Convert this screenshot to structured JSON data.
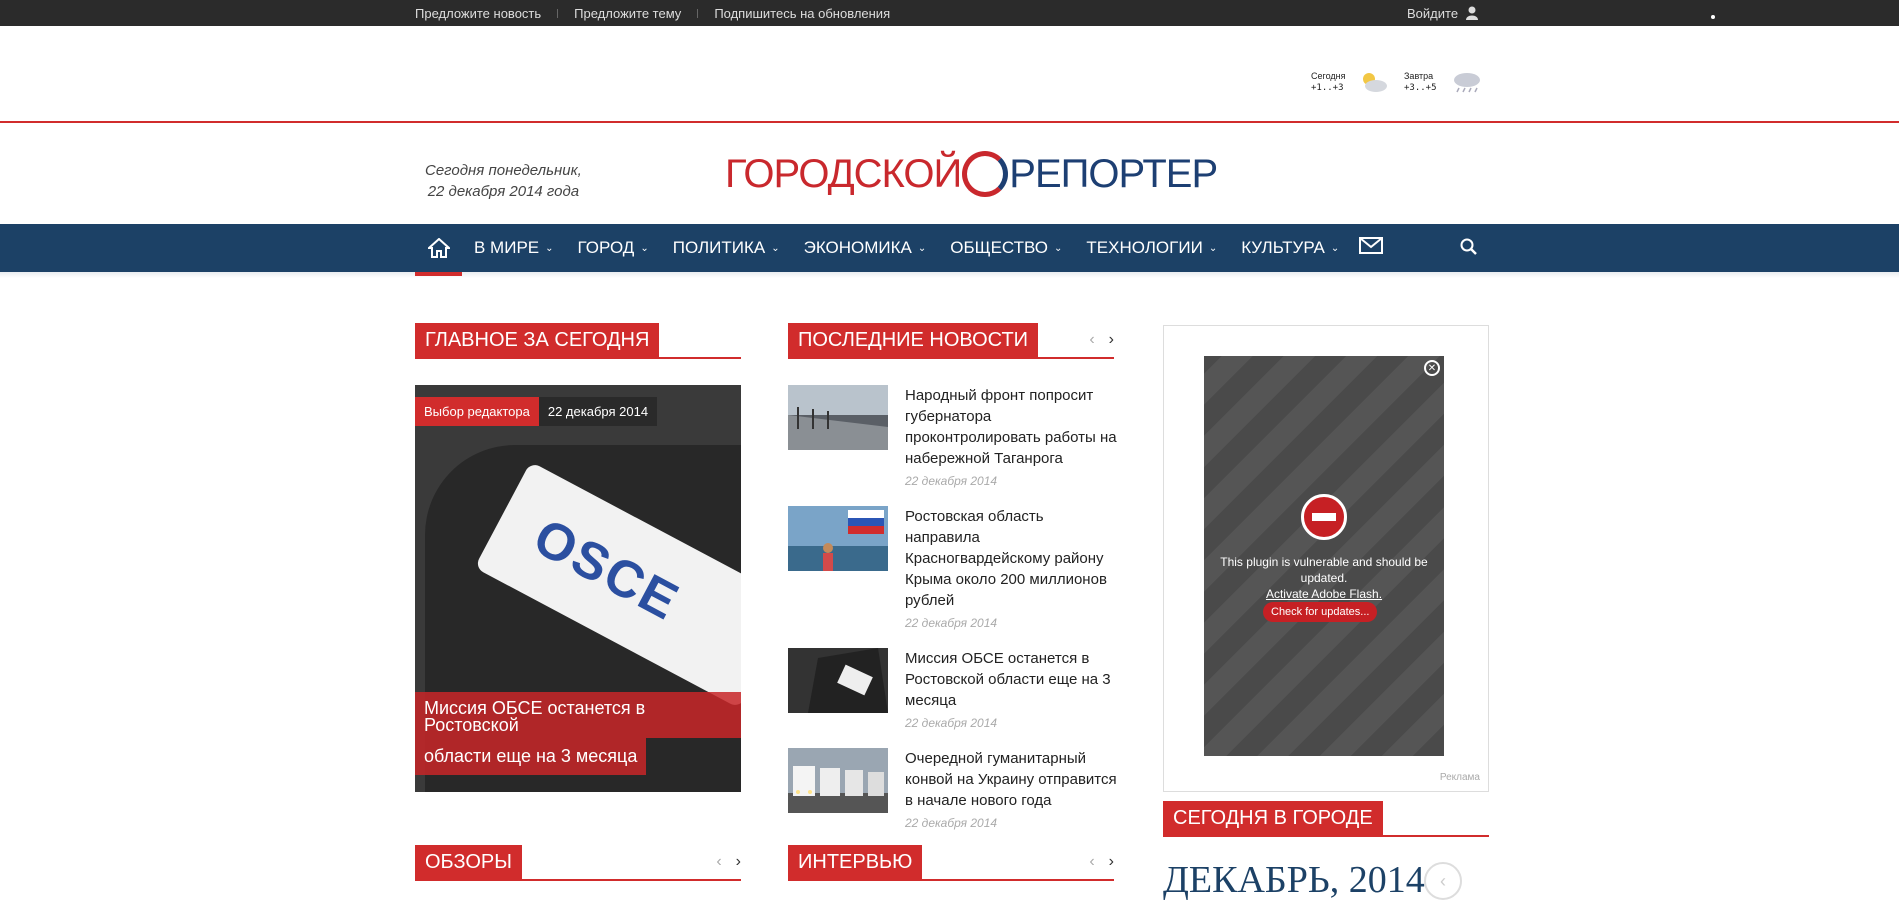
{
  "topbar": {
    "links": [
      "Предложите новость",
      "Предложите тему",
      "Подпишитесь на обновления"
    ],
    "login": "Войдите"
  },
  "weather": {
    "today_label": "Сегодня",
    "today_value": "+1..+3",
    "tomorrow_label": "Завтра",
    "tomorrow_value": "+3..+5"
  },
  "header": {
    "date_line1": "Сегодня понедельник,",
    "date_line2": "22 декабря 2014 года",
    "logo_left": "ГОРОДСКОЙ",
    "logo_right": "РЕПОРТЕР"
  },
  "nav": {
    "items": [
      "В МИРЕ",
      "ГОРОД",
      "ПОЛИТИКА",
      "ЭКОНОМИКА",
      "ОБЩЕСТВО",
      "ТЕХНОЛОГИИ",
      "КУЛЬТУРА"
    ]
  },
  "sections": {
    "main": "ГЛАВНОЕ ЗА СЕГОДНЯ",
    "latest": "ПОСЛЕДНИЕ НОВОСТИ",
    "reviews": "ОБЗОРЫ",
    "interview": "ИНТЕРВЬЮ",
    "city_today": "СЕГОДНЯ В ГОРОДЕ"
  },
  "featured": {
    "tag": "Выбор редактора",
    "date": "22 декабря 2014",
    "caption1": "Миссия ОБСЕ останется в Ростовской",
    "caption2": "области еще на 3 месяца",
    "armband": "OSCE"
  },
  "news": [
    {
      "title": "Народный фронт попросит губернатора проконтролировать работы на набережной Таганрога",
      "date": "22 декабря 2014"
    },
    {
      "title": "Ростовская область направила Красногвардейскому району Крыма около 200 миллионов рублей",
      "date": "22 декабря 2014"
    },
    {
      "title": "Миссия ОБСЕ останется в Ростовской области еще на 3 месяца",
      "date": "22 декабря 2014"
    },
    {
      "title": "Очередной гуманитарный конвой на Украину отправится в начале нового года",
      "date": "22 декабря 2014"
    }
  ],
  "ad": {
    "msg1": "This plugin is vulnerable and should be updated.",
    "link": "Activate Adobe Flash.",
    "button": "Check for updates...",
    "label": "Реклама"
  },
  "calendar": {
    "title": "ДЕКАБРЬ, 2014"
  }
}
